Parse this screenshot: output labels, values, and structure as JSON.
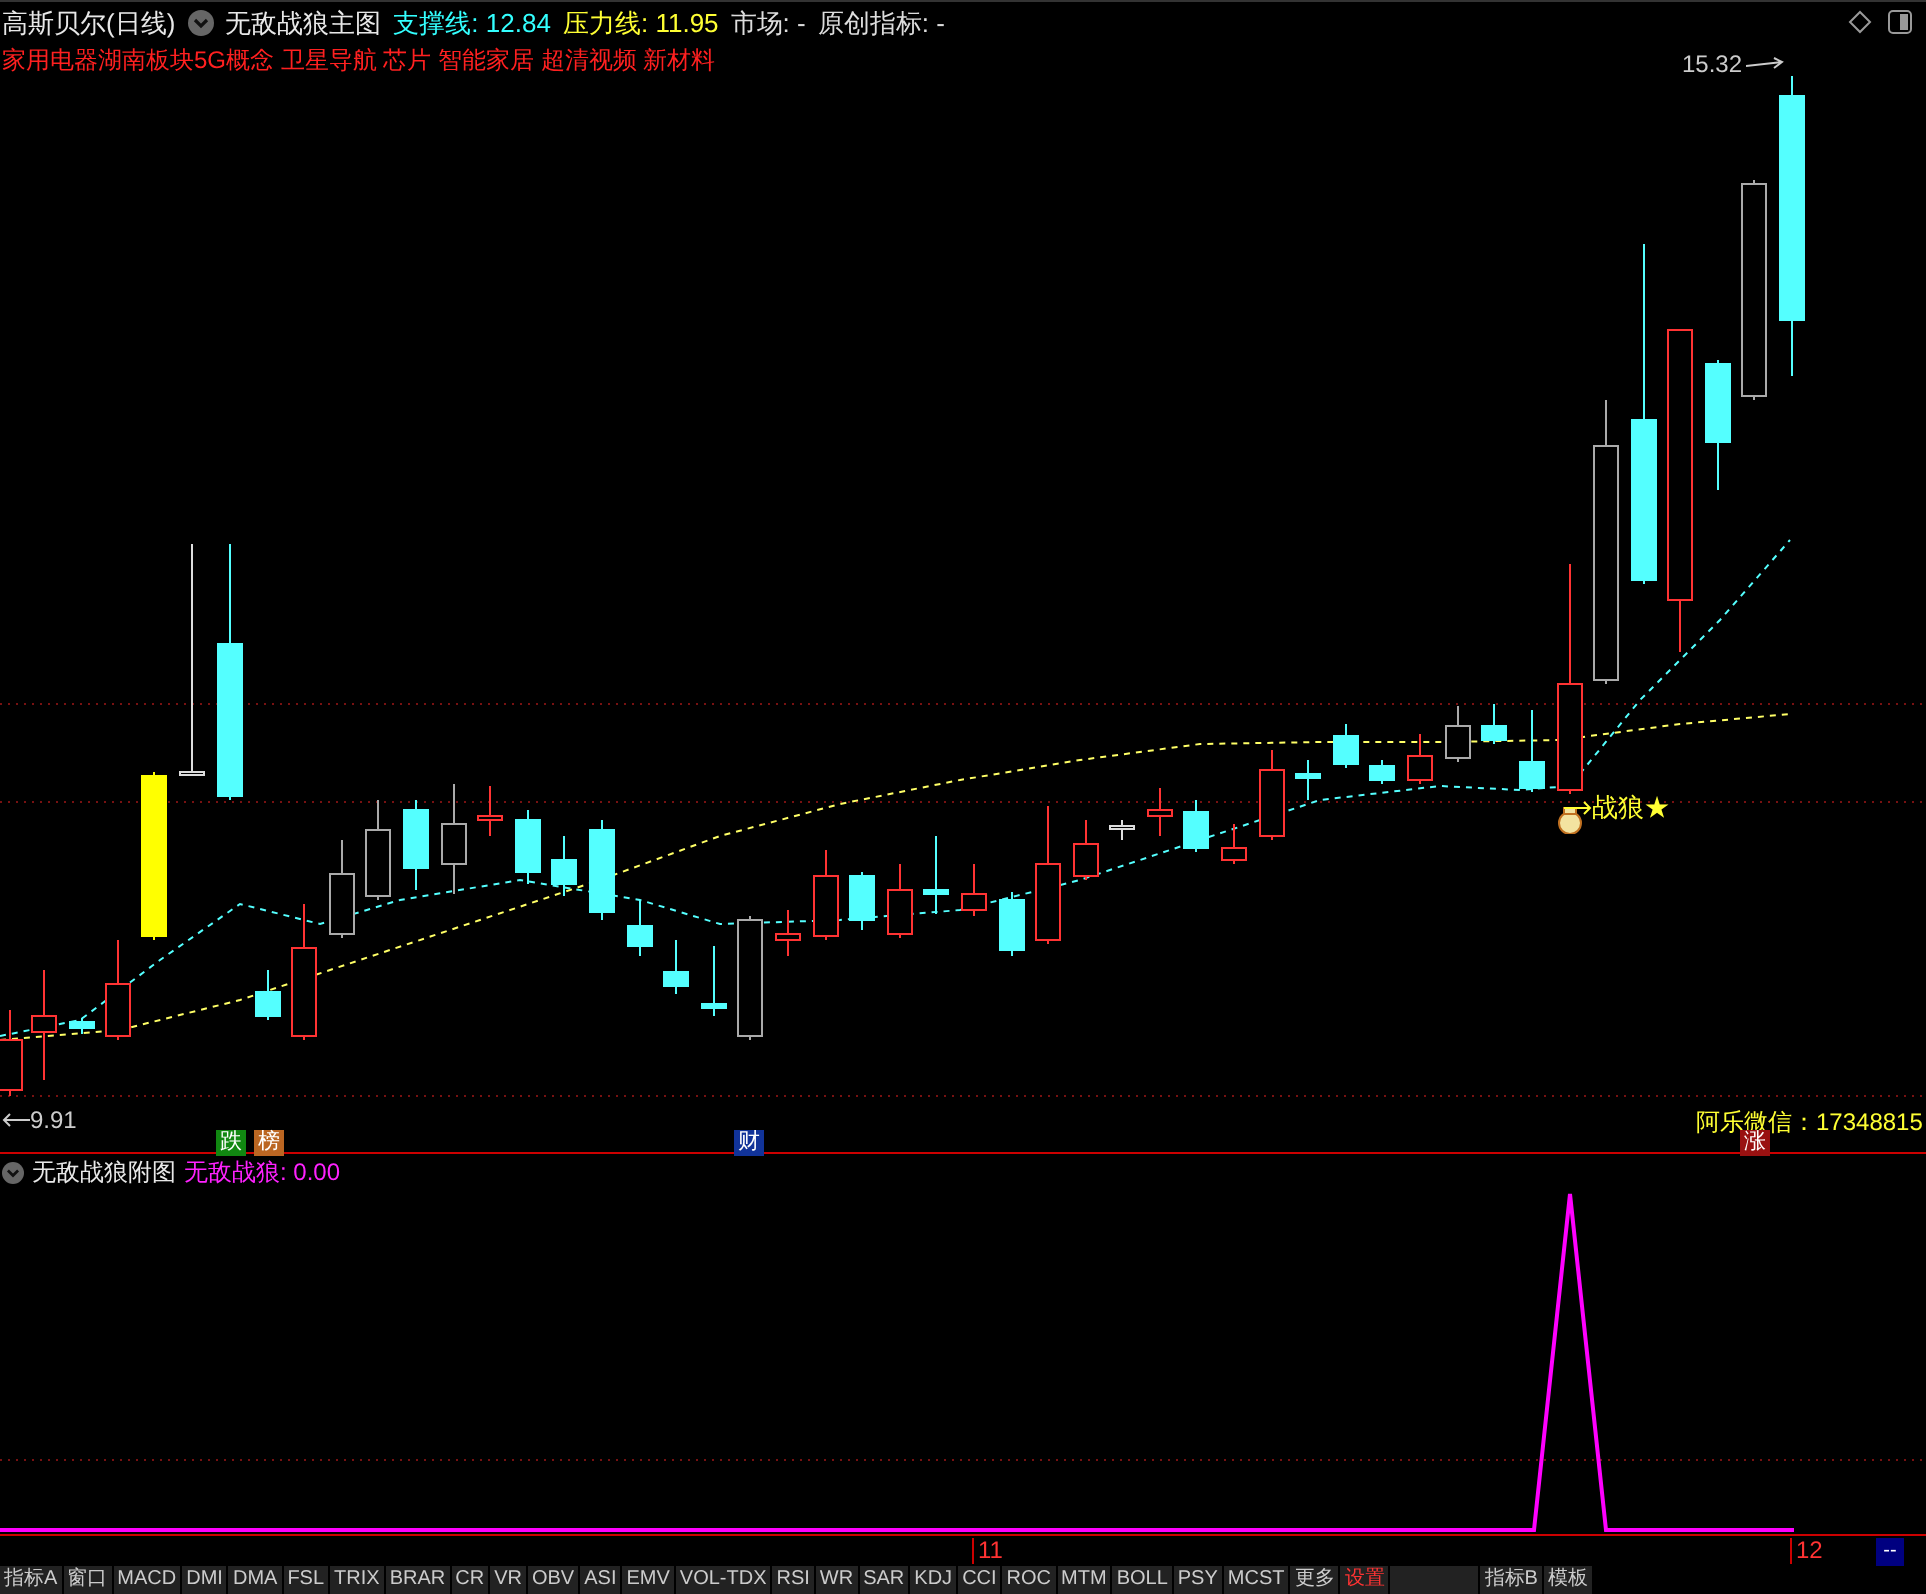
{
  "header": {
    "stock": "高斯贝尔(日线)",
    "indicator": "无敌战狼主图",
    "readings": [
      {
        "label": "支撑线:",
        "value": "12.84",
        "color": "#33ffff"
      },
      {
        "label": "压力线:",
        "value": "11.95",
        "color": "#ffff33"
      },
      {
        "label": "市场:",
        "value": "-",
        "color": "#dddddd"
      },
      {
        "label": "原创指标:",
        "value": "-",
        "color": "#dddddd"
      }
    ]
  },
  "tags": "家用电器湖南板块5G概念 卫星导航 芯片 智能家居 超清视频 新材料",
  "main_chart": {
    "high_label": "15.32",
    "low_label": "9.91",
    "signal": "战狼★",
    "note": "阿乐微信：17348815",
    "markers": [
      {
        "text": "跌",
        "color": "#118811"
      },
      {
        "text": "榜",
        "color": "#bb6622"
      },
      {
        "text": "财",
        "color": "#113399"
      },
      {
        "text": "涨",
        "color": "#991111"
      }
    ]
  },
  "sub_chart": {
    "title": "无敌战狼附图",
    "reading": "无敌战狼: 0.00"
  },
  "axis": {
    "labels": [
      "11",
      "12"
    ],
    "end_button": "--"
  },
  "tabs": [
    {
      "label": "指标A",
      "kind": "indicator"
    },
    {
      "label": "窗口",
      "kind": "indicator"
    },
    {
      "label": "MACD",
      "kind": "indicator"
    },
    {
      "label": "DMI",
      "kind": "indicator"
    },
    {
      "label": "DMA",
      "kind": "indicator"
    },
    {
      "label": "FSL",
      "kind": "indicator"
    },
    {
      "label": "TRIX",
      "kind": "indicator"
    },
    {
      "label": "BRAR",
      "kind": "indicator"
    },
    {
      "label": "CR",
      "kind": "indicator"
    },
    {
      "label": "VR",
      "kind": "indicator"
    },
    {
      "label": "OBV",
      "kind": "indicator"
    },
    {
      "label": "ASI",
      "kind": "indicator"
    },
    {
      "label": "EMV",
      "kind": "indicator"
    },
    {
      "label": "VOL-TDX",
      "kind": "indicator"
    },
    {
      "label": "RSI",
      "kind": "indicator"
    },
    {
      "label": "WR",
      "kind": "indicator"
    },
    {
      "label": "SAR",
      "kind": "indicator"
    },
    {
      "label": "KDJ",
      "kind": "indicator"
    },
    {
      "label": "CCI",
      "kind": "indicator"
    },
    {
      "label": "ROC",
      "kind": "indicator"
    },
    {
      "label": "MTM",
      "kind": "indicator"
    },
    {
      "label": "BOLL",
      "kind": "indicator"
    },
    {
      "label": "PSY",
      "kind": "indicator"
    },
    {
      "label": "MCST",
      "kind": "indicator"
    },
    {
      "label": "更多",
      "kind": "indicator"
    },
    {
      "label": "设置",
      "kind": "setting"
    },
    {
      "label": "指标B",
      "kind": "indicator"
    },
    {
      "label": "模板",
      "kind": "indicator"
    }
  ]
}
